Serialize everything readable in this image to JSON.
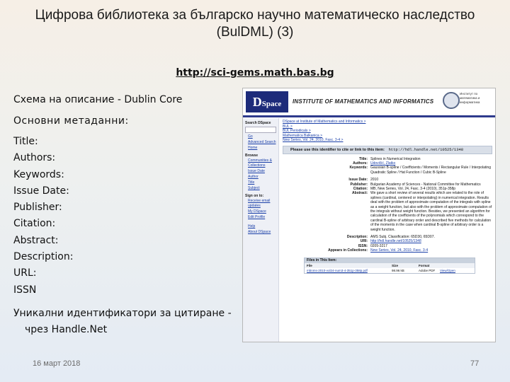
{
  "slide": {
    "title": "Цифрова библиотека за българско научно математическо наследство (BulDML) (3)",
    "url": "http://sci-gems.math.bas.bg",
    "schema_line": "Схема на описание - Dublin Core",
    "metadata_heading": "Основни метаданни:",
    "metadata_fields": [
      "Title:",
      "Authors:",
      "Keywords:",
      "Issue Date:",
      "Publisher:",
      "Citation:",
      "Abstract:",
      "Description:",
      "URL:",
      "ISSN"
    ],
    "unique_line1": "Уникални идентификатори за цитиране -",
    "unique_line2": "чрез Handle.Net",
    "date": "16 март 2018",
    "page_number": "77"
  },
  "screenshot": {
    "logo_d": "D",
    "logo_space": "Space",
    "institute": "INSTITUTE OF MATHEMATICS AND INFORMATICS",
    "institute_sub": "Институт по математика и информатика",
    "sidebar": {
      "search_heading": "Search DSpace",
      "go": "Go",
      "advanced": "Advanced Search",
      "home": "Home",
      "browse_heading": "Browse",
      "browse_items": [
        "Communities & Collections",
        "Issue Date",
        "Author",
        "Title",
        "Subject"
      ],
      "signon_heading": "Sign on to:",
      "signon_items": [
        "Receive email updates",
        "My DSpace",
        "Edit Profile"
      ],
      "help": "Help",
      "about": "About DSpace"
    },
    "breadcrumbs": [
      "DSpace at Institute of Mathematics and Informatics >",
      "BUL >",
      "BUL Periodicals >",
      "Mathematica Balkanica >",
      "New Series, Vol. 24, 2010, Fasc. 3-4 >"
    ],
    "handle_label": "Please use this identifier to cite or link to this item:",
    "handle_url": "http://hdl.handle.net/10525/1348",
    "record": {
      "title_k": "Title:",
      "title_v": "Splines in Numerical Integration",
      "authors_k": "Authors:",
      "authors_v": "Udovičić, Zlatko",
      "keywords_k": "Keywords:",
      "keywords_v": "Gaussian B-spline / Coefficients / Moments / Rectangular Rule / Interpolating Quadratic Spline / Hat Function / Cubic B-Spline",
      "issue_k": "Issue Date:",
      "issue_v": "2010",
      "publisher_k": "Publisher:",
      "publisher_v": "Bulgarian Academy of Sciences - National Committee for Mathematics",
      "citation_k": "Citation:",
      "citation_v": "MB, New Series, Vol. 24, Fasc. 3-4 (2010), 351p-358p",
      "abstract_k": "Abstract:",
      "abstract_v": "We gave a short review of several results which are related to the role of splines (cardinal, centered or interpolating) in numerical integration. Results deal with the problem of approximate computation of the integrals with spline as a weight function, but also with the problem of approximate computation of the integrals without weight function. Besides, we presented an algorithm for calculation of the coefficients of the polynomials which correspond to the cardinal B-spline of arbitrary order and described five methods for calculation of the moments in the case when cardinal B-spline of arbitrary order is a weight function.",
      "description_k": "Description:",
      "description_v": "AMS Subj. Classification: 65D30, 65D07.",
      "uri_k": "URI:",
      "uri_v": "http://hdl.handle.net/10525/1348",
      "issn_k": "ISSN:",
      "issn_v": "0205-3217",
      "appears_k": "Appears in Collections:",
      "appears_v": "New Series, Vol. 24, 2010, Fasc. 3-4"
    },
    "files": {
      "heading": "Files in This Item:",
      "col_file": "File",
      "col_size": "Size",
      "col_format": "Format",
      "file_name": "mbnms-2010-vol24-num3-4-351p-358p.pdf",
      "file_size": "98.96 kB",
      "file_format": "Adobe PDF",
      "file_action": "View/Open"
    }
  },
  "colors": {
    "dspace_blue": "#1d2b7a",
    "link": "#1a3fa8",
    "handle_bar": "#d9dfe8"
  }
}
